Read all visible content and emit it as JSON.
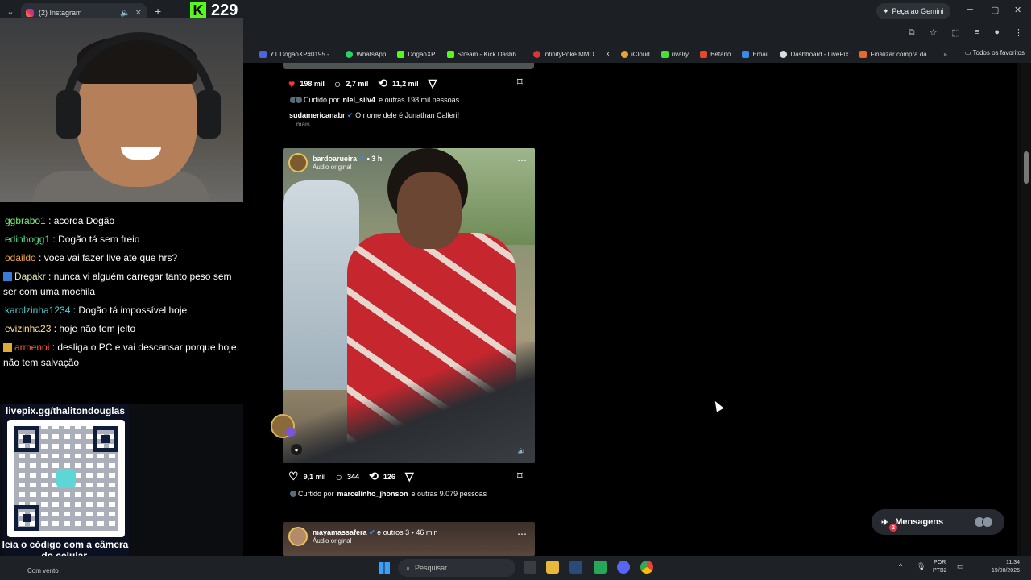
{
  "browser": {
    "tab_title": "(2) Instagram",
    "kick_viewers": "229",
    "gemini_label": "Peça ao Gemini",
    "bookmarks": [
      "YT DogaoXP#0195 -...",
      "WhatsApp",
      "DogaoXP",
      "Stream - Kick Dashb...",
      "InfinityPoke MMO",
      "X",
      "iCloud",
      "rivalry",
      "Betano",
      "Email",
      "Dashboard - LivePix",
      "Finalizar compra da..."
    ],
    "bookmarks_all": "Todos os favoritos"
  },
  "post1": {
    "likes": "198 mil",
    "comments": "2,7 mil",
    "reposts": "11,2 mil",
    "liked_prefix": "Curtido por",
    "liked_user": "nlel_silv4",
    "liked_suffix": "e outras 198 mil pessoas",
    "caption_user": "sudamericanabr",
    "caption_text": "O nome dele é Jonathan Calleri!",
    "more": "... mais"
  },
  "post2": {
    "user": "bardoarueira",
    "time": "3 h",
    "audio": "Áudio original",
    "likes": "9,1 mil",
    "comments": "344",
    "reposts": "126",
    "liked_prefix": "Curtido por",
    "liked_user": "marcelinho_jhonson",
    "liked_suffix": "e outras 9.079 pessoas"
  },
  "post3": {
    "user": "mayamassafera",
    "others": "e outros 3",
    "time": "46 min",
    "audio": "Áudio original"
  },
  "messages": {
    "label": "Mensagens",
    "badge": "2"
  },
  "chat": [
    {
      "user": "ggbrabo1",
      "text": ": acorda Dogão"
    },
    {
      "user": "edinhogg1",
      "text": ": Dogão tá sem freio"
    },
    {
      "user": "odaildo",
      "text": ": voce vai fazer live ate que hrs?"
    },
    {
      "user": "Dapakr",
      "text": ": nunca vi alguém carregar tanto peso sem ser com uma mochila"
    },
    {
      "user": "karolzinha1234",
      "text": ": Dogão tá impossível hoje"
    },
    {
      "user": "evizinha23",
      "text": ": hoje não tem jeito"
    },
    {
      "user": "armenoi",
      "text": ": desliga o PC e vai descansar porque hoje não tem salvação"
    }
  ],
  "overlay": {
    "qr_title": "livepix.gg/thalitondouglas",
    "qr_text": "leia o código com a câmera do celular."
  },
  "taskbar": {
    "weather": "Com vento",
    "search": "Pesquisar",
    "lang1": "POR",
    "lang2": "PTB2",
    "time": "11:34",
    "date": "19/08/2026"
  },
  "colors": {
    "kick_green": "#53fc18",
    "like_red": "#ff3040",
    "instagram_bg": "#000000"
  }
}
